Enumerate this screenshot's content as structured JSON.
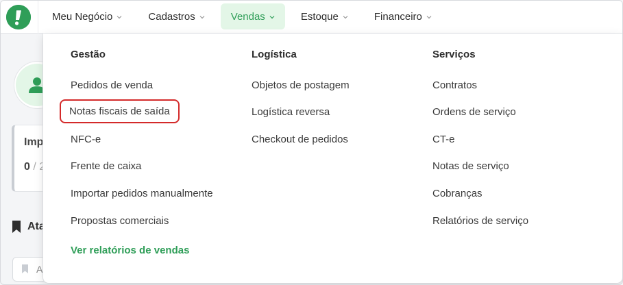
{
  "nav": {
    "items": [
      {
        "label": "Meu Negócio"
      },
      {
        "label": "Cadastros"
      },
      {
        "label": "Vendas"
      },
      {
        "label": "Estoque"
      },
      {
        "label": "Financeiro"
      }
    ],
    "active_index": 2
  },
  "background": {
    "card_title": "Imp",
    "card_value": "0",
    "card_value_sep": "/ 2",
    "section_title": "Ata",
    "input_placeholder": "A"
  },
  "menu": {
    "gestao": {
      "title": "Gestão",
      "items": [
        "Pedidos de venda",
        "Notas fiscais de saída",
        "NFC-e",
        "Frente de caixa",
        "Importar pedidos manualmente",
        "Propostas comerciais"
      ],
      "reports_link": "Ver relatórios de vendas"
    },
    "logistica": {
      "title": "Logística",
      "items": [
        "Objetos de postagem",
        "Logística reversa",
        "Checkout de pedidos"
      ]
    },
    "servicos": {
      "title": "Serviços",
      "items": [
        "Contratos",
        "Ordens de serviço",
        "CT-e",
        "Notas de serviço",
        "Cobranças",
        "Relatórios de serviço"
      ]
    }
  },
  "colors": {
    "brand_green": "#2f9e58",
    "active_tab_bg": "#e3f6e7",
    "highlight_outline": "#d42a2a"
  },
  "icons": [
    "brand-logo-icon",
    "chevron-down-icon",
    "user-icon",
    "bookmark-icon"
  ]
}
